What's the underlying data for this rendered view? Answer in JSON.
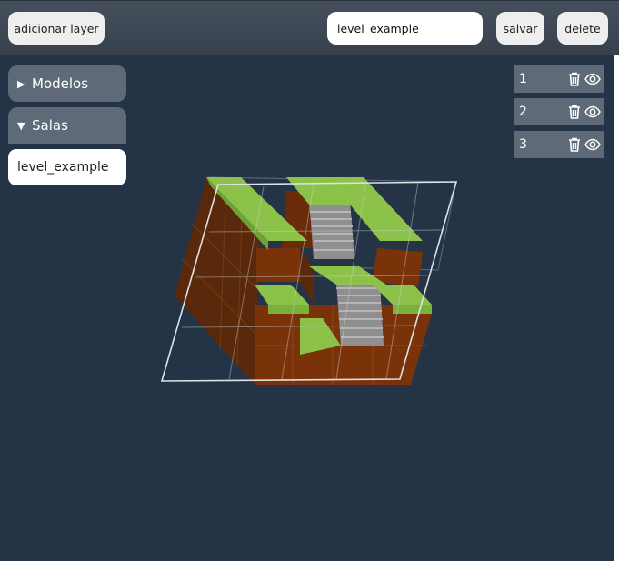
{
  "toolbar": {
    "add_layer_label": "adicionar layer",
    "level_name_value": "level_example",
    "save_label": "salvar",
    "delete_label": "delete"
  },
  "sidebar": {
    "models_label": "Modelos",
    "rooms_label": "Salas",
    "rooms": [
      "level_example"
    ]
  },
  "layers": [
    {
      "label": "1",
      "icons": [
        "trash-icon",
        "eye-icon"
      ]
    },
    {
      "label": "2",
      "icons": [
        "trash-icon",
        "eye-icon"
      ]
    },
    {
      "label": "3",
      "icons": [
        "trash-icon",
        "eye-icon"
      ]
    }
  ],
  "viewport": {
    "colors": {
      "grass": "#8dc24a",
      "dirt": "#6b2f0a",
      "stone": "#9a9a9a",
      "grid": "#d8dde2"
    }
  }
}
